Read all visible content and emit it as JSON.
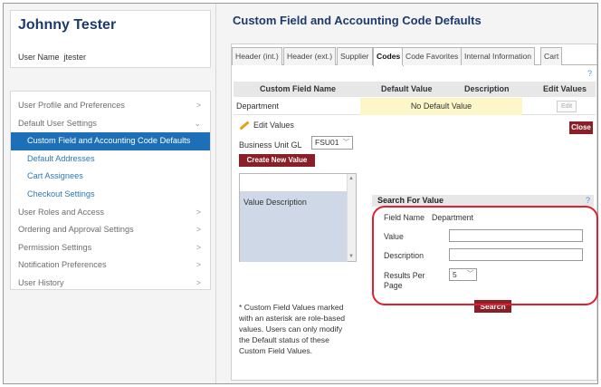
{
  "user": {
    "display_name": "Johnny Tester",
    "user_name_label": "User Name",
    "user_name_value": "jtester"
  },
  "sidebar": {
    "items": [
      {
        "label": "User Profile and Preferences",
        "chevron": ">"
      },
      {
        "label": "Default User Settings",
        "chevron": "⌄"
      },
      {
        "label": "Custom Field and Accounting Code Defaults",
        "chevron": ""
      },
      {
        "label": "Default Addresses",
        "chevron": ""
      },
      {
        "label": "Cart Assignees",
        "chevron": ""
      },
      {
        "label": "Checkout Settings",
        "chevron": ""
      },
      {
        "label": "User Roles and Access",
        "chevron": ">"
      },
      {
        "label": "Ordering and Approval Settings",
        "chevron": ">"
      },
      {
        "label": "Permission Settings",
        "chevron": ">"
      },
      {
        "label": "Notification Preferences",
        "chevron": ">"
      },
      {
        "label": "User History",
        "chevron": ">"
      }
    ]
  },
  "main": {
    "title": "Custom Field and Accounting Code Defaults",
    "tabs": [
      {
        "label": "Header (int.)"
      },
      {
        "label": "Header (ext.)"
      },
      {
        "label": "Supplier"
      },
      {
        "label": "Codes"
      },
      {
        "label": "Code Favorites"
      },
      {
        "label": "Internal Information"
      },
      {
        "label": "Cart"
      }
    ],
    "help_symbol": "?"
  },
  "grid": {
    "headers": {
      "name": "Custom Field Name",
      "default": "Default Value",
      "description": "Description",
      "edit": "Edit Values"
    },
    "row": {
      "name": "Department",
      "default_value": "No Default Value",
      "edit_label": "Edit"
    }
  },
  "edit_values": {
    "title": "Edit Values",
    "close_label": "Close",
    "business_unit_label": "Business Unit GL",
    "business_unit_value": "FSU01",
    "create_button": "Create New Value",
    "list_headers": "Value    Description",
    "note": "* Custom Field Values marked with an asterisk are role-based values. Users can only modify the Default status of these Custom Field Values."
  },
  "search": {
    "title": "Search For Value",
    "help_symbol": "?",
    "field_name_label": "Field Name",
    "field_name_value": "Department",
    "value_label": "Value",
    "value_input": "",
    "description_label": "Description",
    "description_input": "",
    "results_per_page_label": "Results Per Page",
    "results_per_page_value": "5",
    "search_button": "Search"
  },
  "colors": {
    "primary_nav": "#1d6fb8",
    "title_navy": "#1d3a6e",
    "button_maroon": "#8b1f28",
    "highlight_red": "#e0202c",
    "default_cell": "#fcf6c8"
  },
  "icons": {
    "pencil": "pencil-icon",
    "chevron": "chevron-icon",
    "help": "help-icon"
  }
}
